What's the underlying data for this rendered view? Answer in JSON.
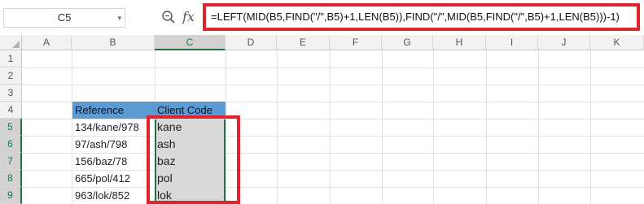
{
  "name_box": {
    "value": "C5"
  },
  "formula_bar": {
    "formula": "=LEFT(MID(B5,FIND(\"/\",B5)+1,LEN(B5)),FIND(\"/\",MID(B5,FIND(\"/\",B5)+1,LEN(B5)))-1)"
  },
  "icons": {
    "zoom": "zoom-icon",
    "fx": "fx-icon",
    "dropdown": "chevron-down-icon"
  },
  "fx_label": "fx",
  "columns": [
    "A",
    "B",
    "C",
    "D",
    "E",
    "F",
    "G",
    "H",
    "I",
    "J",
    "K"
  ],
  "rows": [
    "1",
    "2",
    "3",
    "4",
    "5",
    "6",
    "7",
    "8",
    "9"
  ],
  "table": {
    "headers": [
      "Reference",
      "Client Code"
    ],
    "rows": [
      [
        "134/kane/978",
        "kane"
      ],
      [
        "97/ash/798",
        "ash"
      ],
      [
        "156/baz/78",
        "baz"
      ],
      [
        "665/pol/412",
        "pol"
      ],
      [
        "963/lok/852",
        "lok"
      ]
    ]
  },
  "colors": {
    "header_fill": "#5b9bd5",
    "selection_fill": "#d9d9d9",
    "highlight_red": "#e0242b",
    "selection_green": "#217346"
  }
}
